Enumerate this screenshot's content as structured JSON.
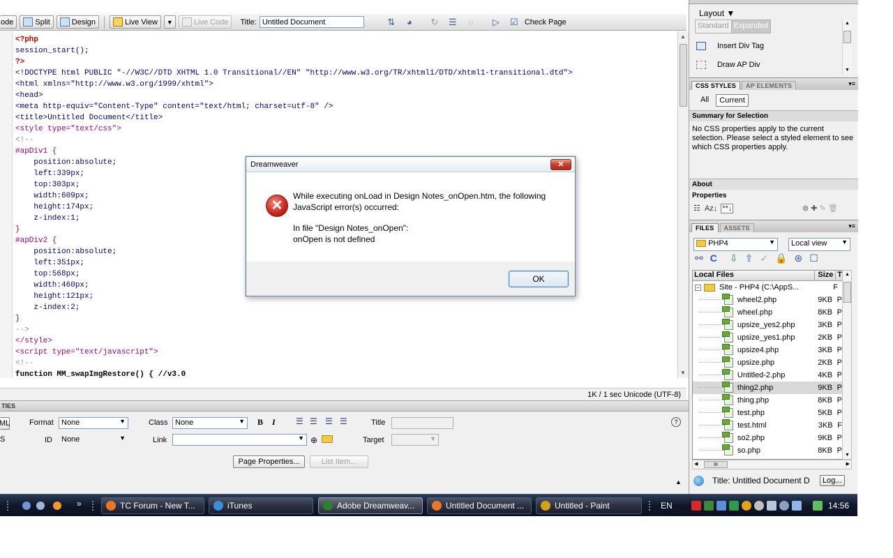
{
  "toolbar": {
    "code_label": "ode",
    "split_label": "Split",
    "design_label": "Design",
    "live_view_label": "Live View",
    "live_code_label": "Live Code",
    "title_label": "Title:",
    "title_value": "Untitled Document",
    "check_page_label": "Check Page"
  },
  "code": {
    "lines": [
      {
        "text": "<?php",
        "kind": "php"
      },
      {
        "text": "session_start();",
        "kind": "tag"
      },
      {
        "text": "?>",
        "kind": "php"
      },
      {
        "text": "<!DOCTYPE html PUBLIC \"-//W3C//DTD XHTML 1.0 Transitional//EN\" \"http://www.w3.org/TR/xhtml1/DTD/xhtml1-transitional.dtd\">",
        "kind": "tag"
      },
      {
        "text": "<html xmlns=\"http://www.w3.org/1999/xhtml\">",
        "kind": "tag"
      },
      {
        "text": "<head>",
        "kind": "tag"
      },
      {
        "text": "<meta http-equiv=\"Content-Type\" content=\"text/html; charset=utf-8\" />",
        "kind": "tag"
      },
      {
        "text": "<title>Untitled Document</title>",
        "kind": "tag"
      },
      {
        "text": "<style type=\"text/css\">",
        "kind": "style"
      },
      {
        "text": "<!--",
        "kind": "comment"
      },
      {
        "text": "#apDiv1 {",
        "kind": "style"
      },
      {
        "text": "    position:absolute;",
        "kind": "prop"
      },
      {
        "text": "    left:339px;",
        "kind": "prop"
      },
      {
        "text": "    top:303px;",
        "kind": "prop"
      },
      {
        "text": "    width:609px;",
        "kind": "prop"
      },
      {
        "text": "    height:174px;",
        "kind": "prop"
      },
      {
        "text": "    z-index:1;",
        "kind": "prop"
      },
      {
        "text": "}",
        "kind": "style"
      },
      {
        "text": "#apDiv2 {",
        "kind": "style"
      },
      {
        "text": "    position:absolute;",
        "kind": "prop"
      },
      {
        "text": "    left:351px;",
        "kind": "prop"
      },
      {
        "text": "    top:568px;",
        "kind": "prop"
      },
      {
        "text": "    width:460px;",
        "kind": "prop"
      },
      {
        "text": "    height:121px;",
        "kind": "prop"
      },
      {
        "text": "    z-index:2;",
        "kind": "prop"
      },
      {
        "text": "}",
        "kind": "style"
      },
      {
        "text": "-->",
        "kind": "comment"
      },
      {
        "text": "</style>",
        "kind": "style"
      },
      {
        "text": "<script type=\"text/javascript\">",
        "kind": "style"
      },
      {
        "text": "<!--",
        "kind": "comment"
      },
      {
        "text": "function MM_swapImgRestore() { //v3.0",
        "kind": "func"
      }
    ]
  },
  "status": {
    "text": "1K / 1 sec  Unicode (UTF-8)"
  },
  "properties": {
    "header": "TIES",
    "left_btn_top": "ML",
    "left_btn_bottom": "S",
    "format_label": "Format",
    "format_value": "None",
    "class_label": "Class",
    "class_value": "None",
    "bold_label": "B",
    "italic_label": "I",
    "title_label": "Title",
    "id_label": "ID",
    "id_value": "None",
    "link_label": "Link",
    "target_label": "Target",
    "page_properties_label": "Page Properties...",
    "list_item_label": "List Item...",
    "help_glyph": "?",
    "expand_glyph": "▲"
  },
  "right_panel": {
    "layout_label": "Layout ▼",
    "standard_label": "Standard",
    "expanded_label": "Expanded",
    "insert_div_label": "Insert Div Tag",
    "draw_ap_label": "Draw AP Div",
    "css_tab": "CSS STYLES",
    "ap_tab": "AP ELEMENTS",
    "all_label": "All",
    "current_label": "Current",
    "summary_header": "Summary for Selection",
    "summary_text": "No CSS properties apply to the current selection.  Please select a styled element to see which CSS properties apply.",
    "about_label": "About",
    "properties_label": "Properties",
    "files_tab": "FILES",
    "assets_tab": "ASSETS",
    "site_select": "PHP4",
    "view_select": "Local view",
    "local_files_header": "Local Files",
    "size_header": "Size",
    "type_header": "T",
    "site_row": "Site - PHP4 (C:\\AppS...",
    "site_row_type": "F",
    "files": [
      {
        "name": "wheel2.php",
        "size": "9KB",
        "type": "P"
      },
      {
        "name": "wheel.php",
        "size": "8KB",
        "type": "P"
      },
      {
        "name": "upsize_yes2.php",
        "size": "3KB",
        "type": "P"
      },
      {
        "name": "upsize_yes1.php",
        "size": "2KB",
        "type": "P"
      },
      {
        "name": "upsize4.php",
        "size": "3KB",
        "type": "P"
      },
      {
        "name": "upsize.php",
        "size": "2KB",
        "type": "P"
      },
      {
        "name": "Untitled-2.php",
        "size": "4KB",
        "type": "P"
      },
      {
        "name": "thing2.php",
        "size": "9KB",
        "type": "P"
      },
      {
        "name": "thing.php",
        "size": "8KB",
        "type": "P"
      },
      {
        "name": "test.php",
        "size": "5KB",
        "type": "P"
      },
      {
        "name": "test.html",
        "size": "3KB",
        "type": "F"
      },
      {
        "name": "so2.php",
        "size": "9KB",
        "type": "P"
      },
      {
        "name": "so.php",
        "size": "8KB",
        "type": "P"
      }
    ],
    "hscroll_glyph": "III",
    "status_title": "Title: Untitled Document  D",
    "log_label": "Log..."
  },
  "dialog": {
    "title": "Dreamweaver",
    "line1": "While executing onLoad in Design Notes_onOpen.htm, the following",
    "line2": "JavaScript error(s) occurred:",
    "line3": "In file \"Design Notes_onOpen\":",
    "line4": "onOpen is not defined",
    "ok_label": "OK",
    "close_glyph": "✕",
    "error_glyph": "✕"
  },
  "taskbar": {
    "items": [
      {
        "label": "TC Forum - New T...",
        "color": "#e8762a"
      },
      {
        "label": "iTunes",
        "color": "#3a8fd8"
      },
      {
        "label": "Adobe Dreamweav...",
        "color": "#2e7d32"
      },
      {
        "label": "Untitled Document ...",
        "color": "#e8762a"
      },
      {
        "label": "Untitled - Paint",
        "color": "#d4a017"
      }
    ],
    "chevron": "»",
    "lang": "EN",
    "clock": "14:56"
  },
  "colors": {
    "accent": "#3c7fb1",
    "error": "#c7261a",
    "taskbar": "#10172a"
  }
}
